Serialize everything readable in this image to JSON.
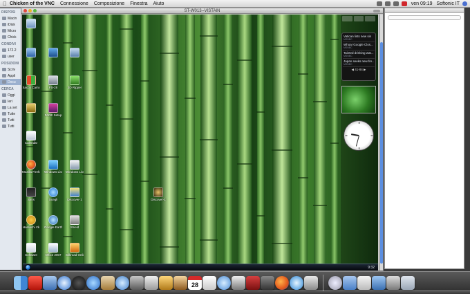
{
  "menubar": {
    "app_name": "Chicken of the VNC",
    "menus": [
      "Connessione",
      "Composizione",
      "Finestra",
      "Aiuto"
    ],
    "clock": "ven 09:19",
    "user": "Softonic IT"
  },
  "vnc_window": {
    "title": "ST-W013--VISTAIN"
  },
  "finder_sidebar": {
    "sections": [
      {
        "title": "DISPOSI",
        "items": [
          "Macin",
          "iDisk",
          "Micro",
          "Chick"
        ]
      },
      {
        "title": "CONDIVI",
        "items": [
          "172.2",
          "user"
        ]
      },
      {
        "title": "POSIZIONI",
        "items": [
          "Scriv",
          "Appli",
          "Docu"
        ]
      },
      {
        "title": "CERCA",
        "items": [
          "Oggi",
          "Ieri",
          "La set",
          "Tutte",
          "Tutti",
          "Tutti"
        ]
      }
    ]
  },
  "desktop_icons": [
    {
      "label": ""
    },
    {
      "label": ""
    },
    {
      "label": "Sacco Carro"
    },
    {
      "label": ""
    },
    {
      "label": ""
    },
    {
      "label": "FS-28"
    },
    {
      "label": "3D Ripper"
    },
    {
      "label": ""
    },
    {
      "label": "FADE Setup"
    },
    {
      "label": "Calendar"
    },
    {
      "label": "Mozilla Firefox"
    },
    {
      "label": "Windows Live Messenger"
    },
    {
      "label": "Windows Live"
    },
    {
      "label": "Discover-1"
    },
    {
      "label": "Sims"
    },
    {
      "label": "Scegli"
    },
    {
      "label": "Discover-1"
    },
    {
      "label": "Hamachi Vk"
    },
    {
      "label": "Google Earth"
    },
    {
      "label": "Shield"
    },
    {
      "label": "Software"
    },
    {
      "label": "Office 2007"
    },
    {
      "label": "Silkroad Online"
    }
  ],
  "news_gadget": {
    "items": [
      {
        "title": "Vatican lists new sin",
        "source": "MSNBC"
      },
      {
        "title": "Whoa! Google Clos...",
        "source": "MSNBC"
      },
      {
        "title": "Tainted drinking wat...",
        "source": "MSNBC"
      },
      {
        "title": "Japan seeks new fre...",
        "source": "MSNBC"
      }
    ],
    "pager": "41-84"
  },
  "taskbar": {
    "tray_time": "9:32"
  },
  "dock": {
    "icons": [
      "finder-icon",
      "pdf-icon",
      "preview-icon",
      "safari-icon",
      "clock-icon",
      "ical-icon",
      "chat-icon",
      "itunes-icon",
      "star-icon",
      "mail-icon",
      "quill-icon",
      "photo-icon",
      "calendar-icon",
      "address-icon",
      "mic-icon",
      "music-icon",
      "vnc-icon",
      "vista-icon",
      "firefox-icon",
      "skype-icon",
      "system-icon",
      "globe-icon",
      "trash-icon"
    ],
    "calendar_day": "28"
  }
}
